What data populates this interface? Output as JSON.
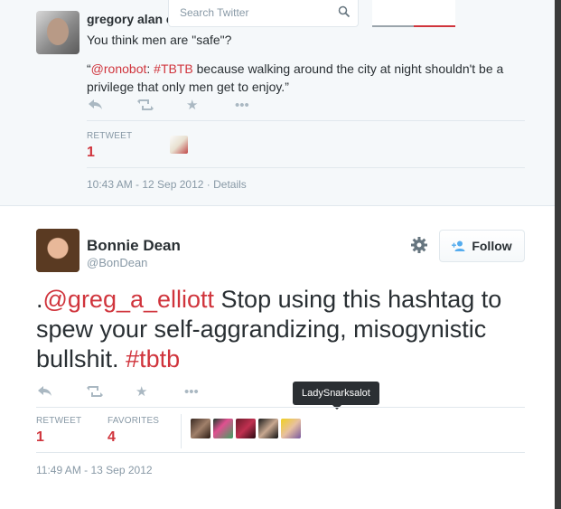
{
  "search": {
    "placeholder": "Search Twitter",
    "icon": "search-icon"
  },
  "parent_tweet": {
    "name": "gregory alan e",
    "line1": "You think men are \"safe\"?",
    "quote_open": "“",
    "quote_mention": "@ronobot",
    "quote_sep": ": ",
    "quote_hashtag": "#TBTB",
    "quote_rest": " because walking around the city at night shouldn't be a privilege that only men get to enjoy.”",
    "retweet_label": "RETWEET",
    "retweet_count": "1",
    "timestamp": "10:43 AM - 12 Sep 2012",
    "details_sep": " · ",
    "details_label": "Details"
  },
  "main_tweet": {
    "name": "Bonnie Dean",
    "handle": "@BonDean",
    "follow_label": "Follow",
    "text_prefix": ".",
    "text_mention": "@greg_a_elliott",
    "text_body": " Stop using this hashtag to spew your self-aggrandizing, misogynistic bullshit. ",
    "text_hashtag": "#tbtb",
    "tooltip": "LadySnarksalot",
    "retweet_label": "RETWEET",
    "retweet_count": "1",
    "favorites_label": "FAVORITES",
    "favorites_count": "4",
    "timestamp": "11:49 AM - 13 Sep 2012"
  },
  "colors": {
    "accent": "#d0343c",
    "muted": "#8899a6",
    "text": "#292f33"
  }
}
